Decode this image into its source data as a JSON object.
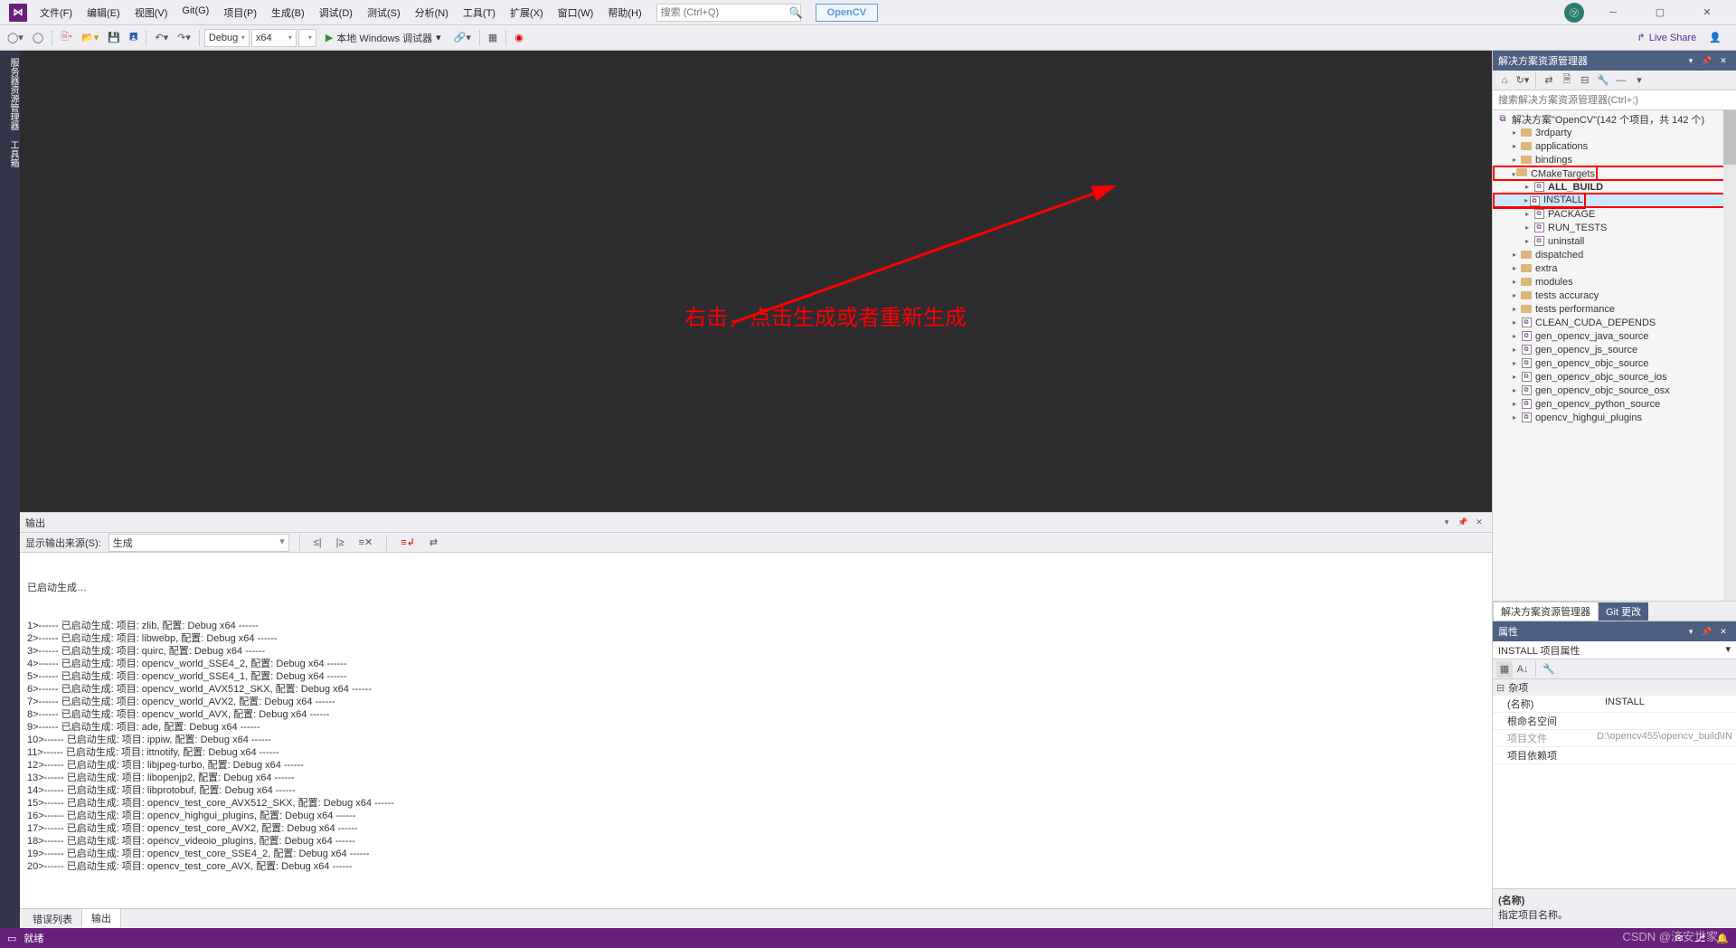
{
  "menubar": {
    "items": [
      "文件(F)",
      "编辑(E)",
      "视图(V)",
      "Git(G)",
      "项目(P)",
      "生成(B)",
      "调试(D)",
      "测试(S)",
      "分析(N)",
      "工具(T)",
      "扩展(X)",
      "窗口(W)",
      "帮助(H)"
    ],
    "search_placeholder": "搜索 (Ctrl+Q)",
    "opencv_btn": "OpenCV"
  },
  "toolbar": {
    "config": "Debug",
    "platform": "x64",
    "start": "本地 Windows 调试器",
    "live_share": "Live Share"
  },
  "left_tab": "服务器资源管理器  工具箱",
  "output": {
    "title": "输出",
    "source_label": "显示输出来源(S):",
    "source_value": "生成",
    "header": "已启动生成…",
    "lines": [
      "1>------ 已启动生成: 项目: zlib, 配置: Debug x64 ------",
      "2>------ 已启动生成: 项目: libwebp, 配置: Debug x64 ------",
      "3>------ 已启动生成: 项目: quirc, 配置: Debug x64 ------",
      "4>------ 已启动生成: 项目: opencv_world_SSE4_2, 配置: Debug x64 ------",
      "5>------ 已启动生成: 项目: opencv_world_SSE4_1, 配置: Debug x64 ------",
      "6>------ 已启动生成: 项目: opencv_world_AVX512_SKX, 配置: Debug x64 ------",
      "7>------ 已启动生成: 项目: opencv_world_AVX2, 配置: Debug x64 ------",
      "8>------ 已启动生成: 项目: opencv_world_AVX, 配置: Debug x64 ------",
      "9>------ 已启动生成: 项目: ade, 配置: Debug x64 ------",
      "10>------ 已启动生成: 项目: ippiw, 配置: Debug x64 ------",
      "11>------ 已启动生成: 项目: ittnotify, 配置: Debug x64 ------",
      "12>------ 已启动生成: 项目: libjpeg-turbo, 配置: Debug x64 ------",
      "13>------ 已启动生成: 项目: libopenjp2, 配置: Debug x64 ------",
      "14>------ 已启动生成: 项目: libprotobuf, 配置: Debug x64 ------",
      "15>------ 已启动生成: 项目: opencv_test_core_AVX512_SKX, 配置: Debug x64 ------",
      "16>------ 已启动生成: 项目: opencv_highgui_plugins, 配置: Debug x64 ------",
      "17>------ 已启动生成: 项目: opencv_test_core_AVX2, 配置: Debug x64 ------",
      "18>------ 已启动生成: 项目: opencv_videoio_plugins, 配置: Debug x64 ------",
      "19>------ 已启动生成: 项目: opencv_test_core_SSE4_2, 配置: Debug x64 ------",
      "20>------ 已启动生成: 项目: opencv_test_core_AVX, 配置: Debug x64 ------"
    ],
    "tabs": {
      "errors": "错误列表",
      "output": "输出"
    }
  },
  "solution": {
    "title": "解决方案资源管理器",
    "search_placeholder": "搜索解决方案资源管理器(Ctrl+;)",
    "root": "解决方案\"OpenCV\"(142 个项目，共 142 个)",
    "nodes": [
      {
        "indent": 1,
        "exp": "▸",
        "type": "folder",
        "label": "3rdparty"
      },
      {
        "indent": 1,
        "exp": "▸",
        "type": "folder",
        "label": "applications"
      },
      {
        "indent": 1,
        "exp": "▸",
        "type": "folder",
        "label": "bindings"
      },
      {
        "indent": 1,
        "exp": "▾",
        "type": "folder",
        "label": "CMakeTargets",
        "highlight": "red"
      },
      {
        "indent": 2,
        "exp": "▸",
        "type": "proj",
        "label": "ALL_BUILD",
        "bold": true
      },
      {
        "indent": 2,
        "exp": "▸",
        "type": "proj",
        "label": "INSTALL",
        "highlight": "red",
        "selected": true
      },
      {
        "indent": 2,
        "exp": "▸",
        "type": "proj",
        "label": "PACKAGE"
      },
      {
        "indent": 2,
        "exp": "▸",
        "type": "proj",
        "label": "RUN_TESTS"
      },
      {
        "indent": 2,
        "exp": "▸",
        "type": "proj",
        "label": "uninstall"
      },
      {
        "indent": 1,
        "exp": "▸",
        "type": "folder",
        "label": "dispatched"
      },
      {
        "indent": 1,
        "exp": "▸",
        "type": "folder",
        "label": "extra"
      },
      {
        "indent": 1,
        "exp": "▸",
        "type": "folder",
        "label": "modules"
      },
      {
        "indent": 1,
        "exp": "▸",
        "type": "folder",
        "label": "tests accuracy"
      },
      {
        "indent": 1,
        "exp": "▸",
        "type": "folder",
        "label": "tests performance"
      },
      {
        "indent": 1,
        "exp": "▸",
        "type": "proj",
        "label": "CLEAN_CUDA_DEPENDS"
      },
      {
        "indent": 1,
        "exp": "▸",
        "type": "proj",
        "label": "gen_opencv_java_source"
      },
      {
        "indent": 1,
        "exp": "▸",
        "type": "proj",
        "label": "gen_opencv_js_source"
      },
      {
        "indent": 1,
        "exp": "▸",
        "type": "proj",
        "label": "gen_opencv_objc_source"
      },
      {
        "indent": 1,
        "exp": "▸",
        "type": "proj",
        "label": "gen_opencv_objc_source_ios"
      },
      {
        "indent": 1,
        "exp": "▸",
        "type": "proj",
        "label": "gen_opencv_objc_source_osx"
      },
      {
        "indent": 1,
        "exp": "▸",
        "type": "proj",
        "label": "gen_opencv_python_source"
      },
      {
        "indent": 1,
        "exp": "▸",
        "type": "proj",
        "label": "opencv_highgui_plugins"
      }
    ],
    "tabs": {
      "sln": "解决方案资源管理器",
      "git": "Git 更改"
    }
  },
  "properties": {
    "title": "属性",
    "combo": "INSTALL 项目属性",
    "category": "杂项",
    "rows": [
      {
        "key": "(名称)",
        "val": "INSTALL"
      },
      {
        "key": "根命名空间",
        "val": ""
      },
      {
        "key": "项目文件",
        "val": "D:\\opencv455\\opencv_build\\IN",
        "gray": true
      },
      {
        "key": "项目依赖项",
        "val": ""
      }
    ],
    "desc_title": "(名称)",
    "desc_text": "指定项目名称。"
  },
  "statusbar": {
    "ready": "就绪",
    "watermark": "CSDN @济安世家"
  },
  "annotation": "右击，点击生成或者重新生成"
}
